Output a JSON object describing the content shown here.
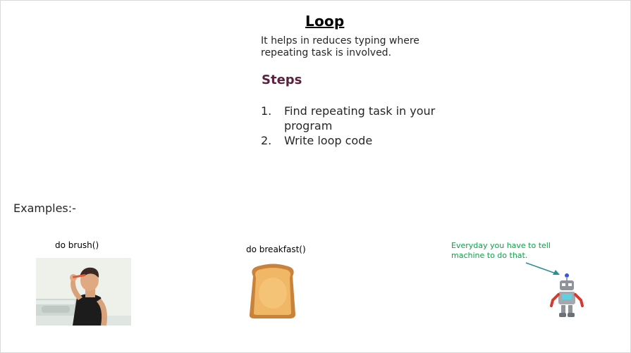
{
  "slide": {
    "title": "Loop",
    "description": "It helps in reduces typing where repeating task is involved.",
    "steps_heading": "Steps",
    "steps": [
      {
        "num": "1.",
        "text": "Find repeating task in your program"
      },
      {
        "num": "2.",
        "text": "Write loop code"
      }
    ],
    "examples_label": "Examples:-",
    "examples": {
      "brush_caption": "do brush()",
      "breakfast_caption": "do breakfast()",
      "robot_note": "Everyday you have to tell machine to do that."
    }
  },
  "colors": {
    "steps_heading": "#5b2240",
    "note_text": "#0e9f4a",
    "arrow": "#2a8f95"
  },
  "icons": [
    "man-brushing-teeth-illustration",
    "toast-illustration",
    "robot-illustration",
    "arrow-icon"
  ]
}
